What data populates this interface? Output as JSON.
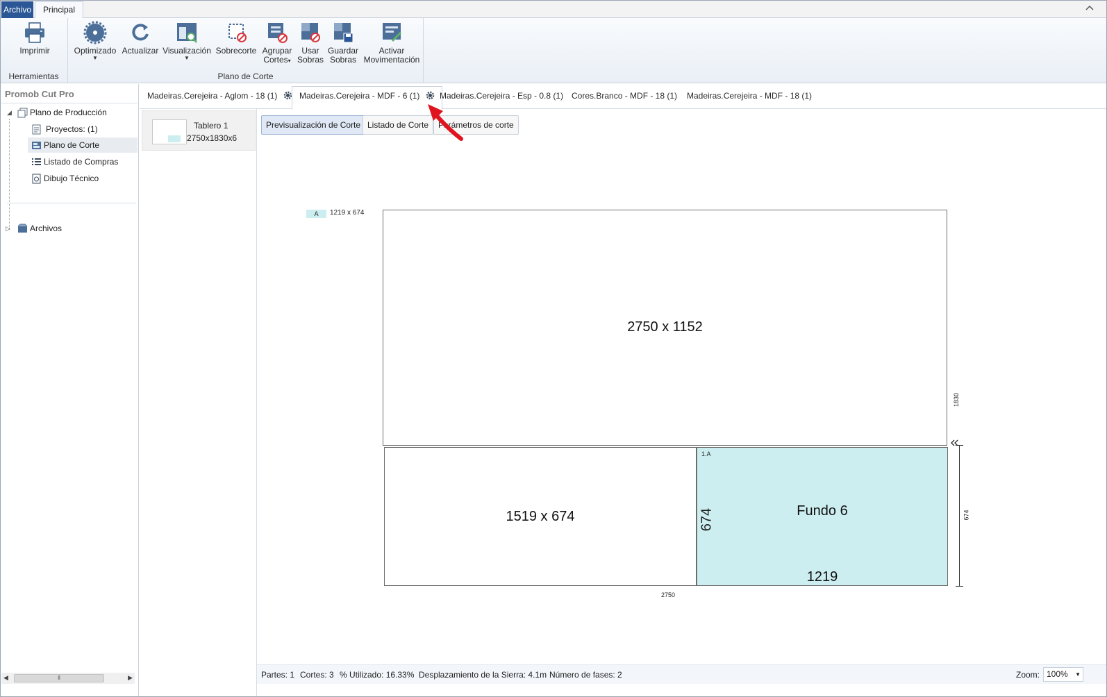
{
  "ribbon_tabs": {
    "archivo": "Archivo",
    "principal": "Principal"
  },
  "ribbon": {
    "groups": [
      {
        "label": "Herramientas"
      },
      {
        "label": "Plano de Corte"
      }
    ],
    "buttons": {
      "imprimir": "Imprimir",
      "optimizado": "Optimizado",
      "actualizar": "Actualizar",
      "visualizacion": "Visualización",
      "sobrecorte": "Sobrecorte",
      "agrupar_1": "Agrupar",
      "agrupar_2": "Cortes",
      "usar_1": "Usar",
      "usar_2": "Sobras",
      "guardar_1": "Guardar",
      "guardar_2": "Sobras",
      "activar_1": "Activar",
      "activar_2": "Movimentación"
    }
  },
  "left_panel": {
    "title": "Promob Cut Pro",
    "tree": {
      "root": "Plano de Producción",
      "items": [
        {
          "label": "Proyectos: (1)"
        },
        {
          "label": "Plano de Corte"
        },
        {
          "label": "Listado de Compras"
        },
        {
          "label": "Dibujo Técnico"
        }
      ],
      "archivos": "Archivos"
    }
  },
  "doc_tabs": [
    {
      "label": "Madeiras.Cerejeira - Aglom - 18 (1)"
    },
    {
      "label": "Madeiras.Cerejeira - MDF - 6 (1)"
    },
    {
      "label": "Madeiras.Cerejeira - Esp - 0.8 (1)"
    },
    {
      "label": "Cores.Branco - MDF - 18 (1)"
    },
    {
      "label": "Madeiras.Cerejeira - MDF - 18 (1)"
    }
  ],
  "board": {
    "name": "Tablero 1",
    "dims": "2750x1830x6"
  },
  "sub_tabs": {
    "preview": "Previsualización de Corte",
    "list": "Listado de Corte",
    "params": "Parámetros de corte"
  },
  "drawing": {
    "legend_letter": "A",
    "legend_dims": "1219 x 674",
    "top_piece": "2750 x 1152",
    "bottom_left_piece": "1519 x 674",
    "part_tag": "1.A",
    "part_name": "Fundo 6",
    "part_height": "674",
    "part_width": "1219",
    "dim_sheet_height": "1830",
    "dim_row_height": "674",
    "dim_sheet_width": "2750"
  },
  "status": {
    "partes": "Partes: 1",
    "cortes": "Cortes: 3",
    "utilizado": "% Utilizado: 16.33%",
    "desplazamiento": "Desplazamiento de la Sierra: 4.1m",
    "fases": "Número de fases: 2",
    "zoom_label": "Zoom:",
    "zoom_value": "100%"
  },
  "colors": {
    "accent": "#2b5797",
    "part_fill": "#cdeef0",
    "annotation_arrow": "#e0141e"
  }
}
